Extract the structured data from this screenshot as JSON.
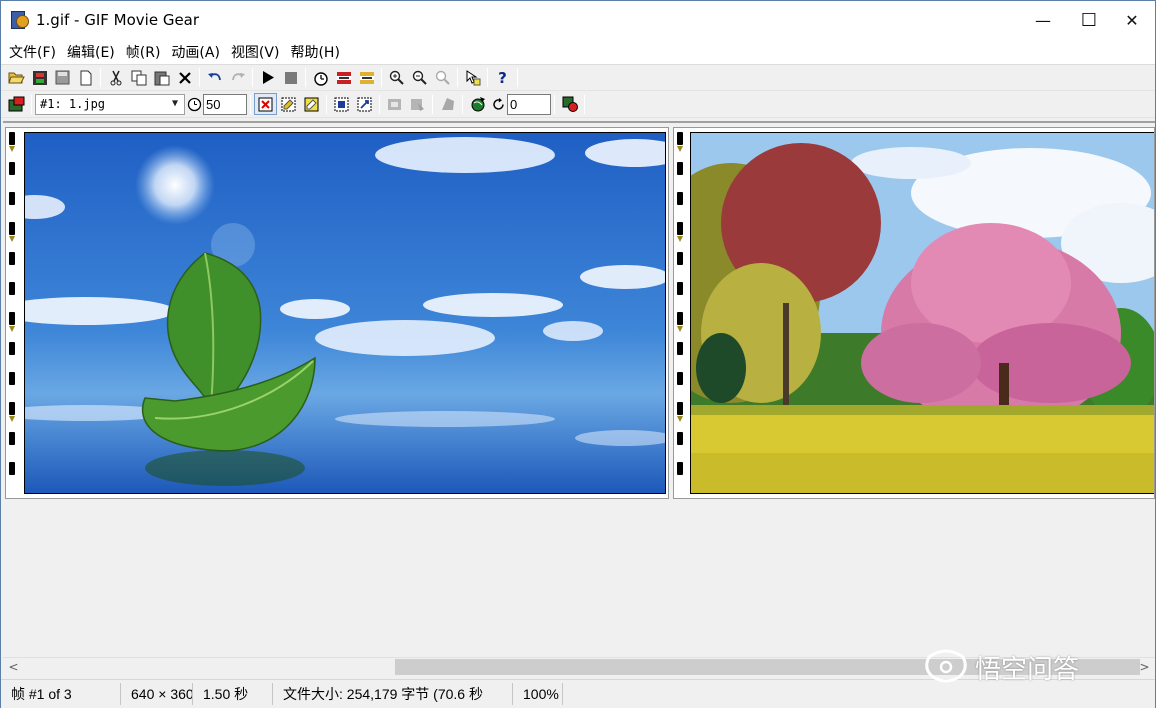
{
  "window": {
    "title": "1.gif - GIF Movie Gear"
  },
  "window_controls": {
    "minimize": "—",
    "maximize": "☐",
    "close": "✕"
  },
  "menu": [
    "文件(F)",
    "编辑(E)",
    "帧(R)",
    "动画(A)",
    "视图(V)",
    "帮助(H)"
  ],
  "toolbar1_icons": [
    "open-icon",
    "film-icon",
    "save-icon",
    "new-file-icon",
    "cut-icon",
    "copy-icon",
    "paste-icon",
    "delete-icon",
    "undo-icon",
    "redo-icon",
    "play-icon",
    "stop-icon",
    "timing-icon",
    "frame-insert-icon",
    "frame-remove-icon",
    "zoom-in-icon",
    "zoom-out-icon",
    "zoom-fit-icon",
    "properties-icon",
    "help-icon"
  ],
  "help_glyph": "?",
  "frame_select": {
    "value": "#1: 1.jpg"
  },
  "frame_delay": {
    "value": "50"
  },
  "loop_count": {
    "value": "0"
  },
  "scrollbar": {
    "left_arrow": "<",
    "right_arrow": ">"
  },
  "status": {
    "frame": "帧 #1 of 3",
    "size": "640 × 360",
    "duration": "1.50 秒",
    "filesize": "文件大小: 254,179 字节  (70.6 秒",
    "zoom": "100%"
  },
  "watermark": {
    "text": "悟空问答"
  },
  "colors": {
    "titlebar": "#ffffff",
    "chrome": "#f0f0f0",
    "window_border": "#5b7fa8",
    "frame_marker": "#9a8a1a"
  }
}
